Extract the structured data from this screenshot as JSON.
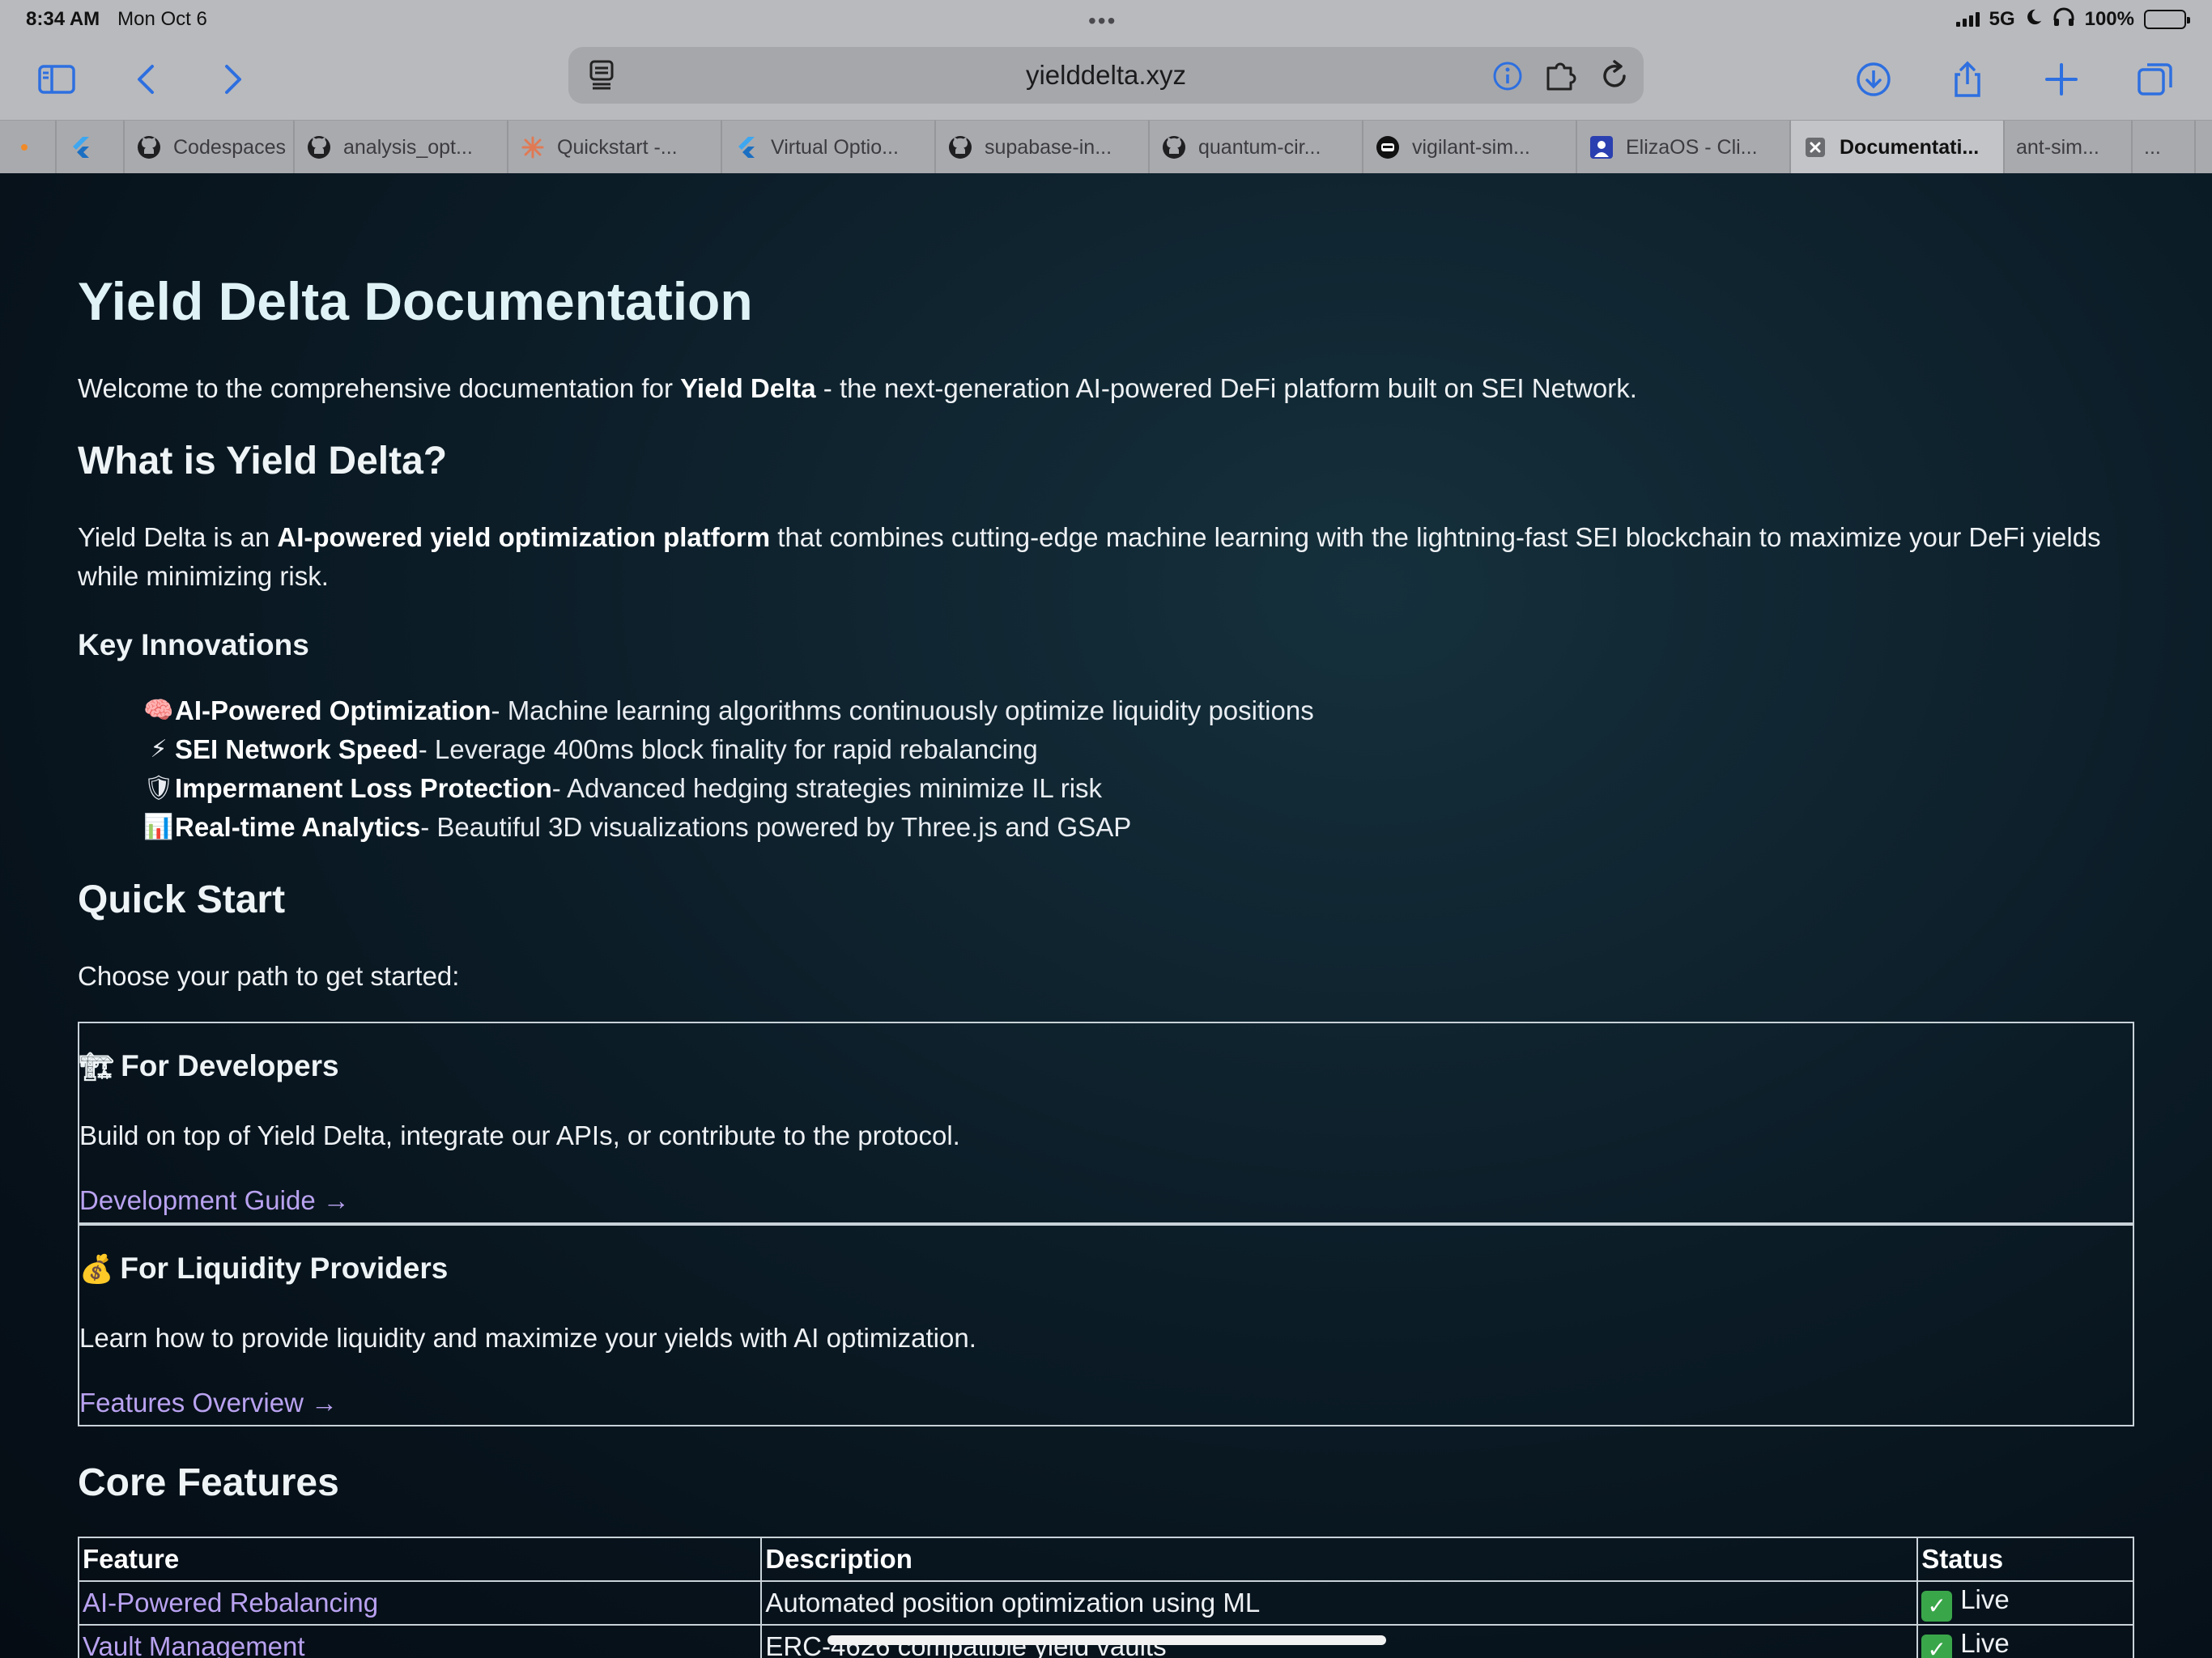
{
  "status_bar": {
    "time": "8:34 AM",
    "date": "Mon Oct 6",
    "network": "5G",
    "battery": "100%"
  },
  "toolbar": {
    "url": "yielddelta.xyz",
    "icons": [
      "sidebar-icon",
      "back-icon",
      "forward-icon",
      "reader-icon",
      "info-icon",
      "extension-icon",
      "reload-icon",
      "download-icon",
      "share-icon",
      "new-tab-icon",
      "tab-overview-icon"
    ]
  },
  "tabs": [
    {
      "label": "",
      "icon": "firefox-icon"
    },
    {
      "label": "",
      "icon": "flutter-icon"
    },
    {
      "label": "Codespaces",
      "icon": "github-icon"
    },
    {
      "label": "analysis_opt...",
      "icon": "github-icon"
    },
    {
      "label": "Quickstart -...",
      "icon": "claude-icon"
    },
    {
      "label": "Virtual Optio...",
      "icon": "flutter-icon"
    },
    {
      "label": "supabase-in...",
      "icon": "github-icon"
    },
    {
      "label": "quantum-cir...",
      "icon": "github-icon"
    },
    {
      "label": "vigilant-sim...",
      "icon": "robot-icon"
    },
    {
      "label": "ElizaOS - Cli...",
      "icon": "eliza-icon"
    },
    {
      "label": "Documentati...",
      "icon": "close-icon",
      "active": true
    },
    {
      "label": "ant-sim...",
      "icon": ""
    },
    {
      "label": "...",
      "icon": ""
    }
  ],
  "doc": {
    "title": "Yield Delta Documentation",
    "intro_prefix": "Welcome to the comprehensive documentation for ",
    "intro_bold": "Yield Delta",
    "intro_suffix": " - the next-generation AI-powered DeFi platform built on SEI Network.",
    "what_heading": "What is Yield Delta?",
    "what_prefix": "Yield Delta is an ",
    "what_bold": "AI-powered yield optimization platform",
    "what_suffix": " that combines cutting-edge machine learning with the lightning-fast SEI blockchain to maximize your DeFi yields while minimizing risk.",
    "innovations_heading": "Key Innovations",
    "innovations": [
      {
        "emoji": "🧠",
        "title": "AI-Powered Optimization",
        "text": "- Machine learning algorithms continuously optimize liquidity positions"
      },
      {
        "emoji": "⚡",
        "title": "SEI Network Speed",
        "text": "- Leverage 400ms block finality for rapid rebalancing"
      },
      {
        "emoji": "🛡",
        "title": "Impermanent Loss Protection",
        "text": "- Advanced hedging strategies minimize IL risk"
      },
      {
        "emoji": "📊",
        "title": "Real-time Analytics",
        "text": "- Beautiful 3D visualizations powered by Three.js and GSAP"
      }
    ],
    "quickstart_heading": "Quick Start",
    "quickstart_text": "Choose your path to get started:",
    "cards": [
      {
        "emoji": "🏗",
        "title": "For Developers",
        "text": "Build on top of Yield Delta, integrate our APIs, or contribute to the protocol.",
        "link": "Development Guide →"
      },
      {
        "emoji": "💰",
        "title": "For Liquidity Providers",
        "text": "Learn how to provide liquidity and maximize your yields with AI optimization.",
        "link": "Features Overview →"
      }
    ],
    "features_heading": "Core Features",
    "table": {
      "headers": [
        "Feature",
        "Description",
        "Status"
      ],
      "rows": [
        [
          "AI-Powered Rebalancing",
          "Automated position optimization using ML",
          "Live"
        ],
        [
          "Vault Management",
          "ERC-4626 compatible yield vaults",
          "Live"
        ]
      ]
    }
  }
}
